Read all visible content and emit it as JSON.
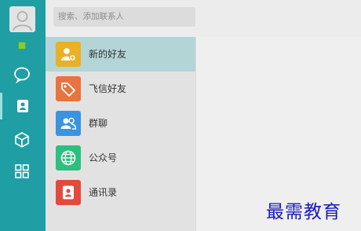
{
  "search": {
    "placeholder": "搜索、添加联系人"
  },
  "rail": {
    "items": [
      {
        "name": "chat",
        "icon": "chat-bubble-icon"
      },
      {
        "name": "contacts",
        "icon": "contacts-card-icon",
        "active": true
      },
      {
        "name": "apps",
        "icon": "cube-icon"
      },
      {
        "name": "more",
        "icon": "grid-icon"
      }
    ],
    "status_color": "#7fcf3a"
  },
  "contacts_menu": [
    {
      "label": "新的好友",
      "icon": "new-friend-icon",
      "color": "#e9b125",
      "selected": true
    },
    {
      "label": "飞信好友",
      "icon": "tag-icon",
      "color": "#e8733f"
    },
    {
      "label": "群聊",
      "icon": "group-icon",
      "color": "#3a94e0"
    },
    {
      "label": "公众号",
      "icon": "globe-icon",
      "color": "#2dbf7f"
    },
    {
      "label": "通讯录",
      "icon": "address-book-icon",
      "color": "#e2493f"
    }
  ],
  "watermark": {
    "text": "最需教育"
  },
  "colors": {
    "rail": "#1f9ea4",
    "selected_row": "#b3d5d6"
  }
}
